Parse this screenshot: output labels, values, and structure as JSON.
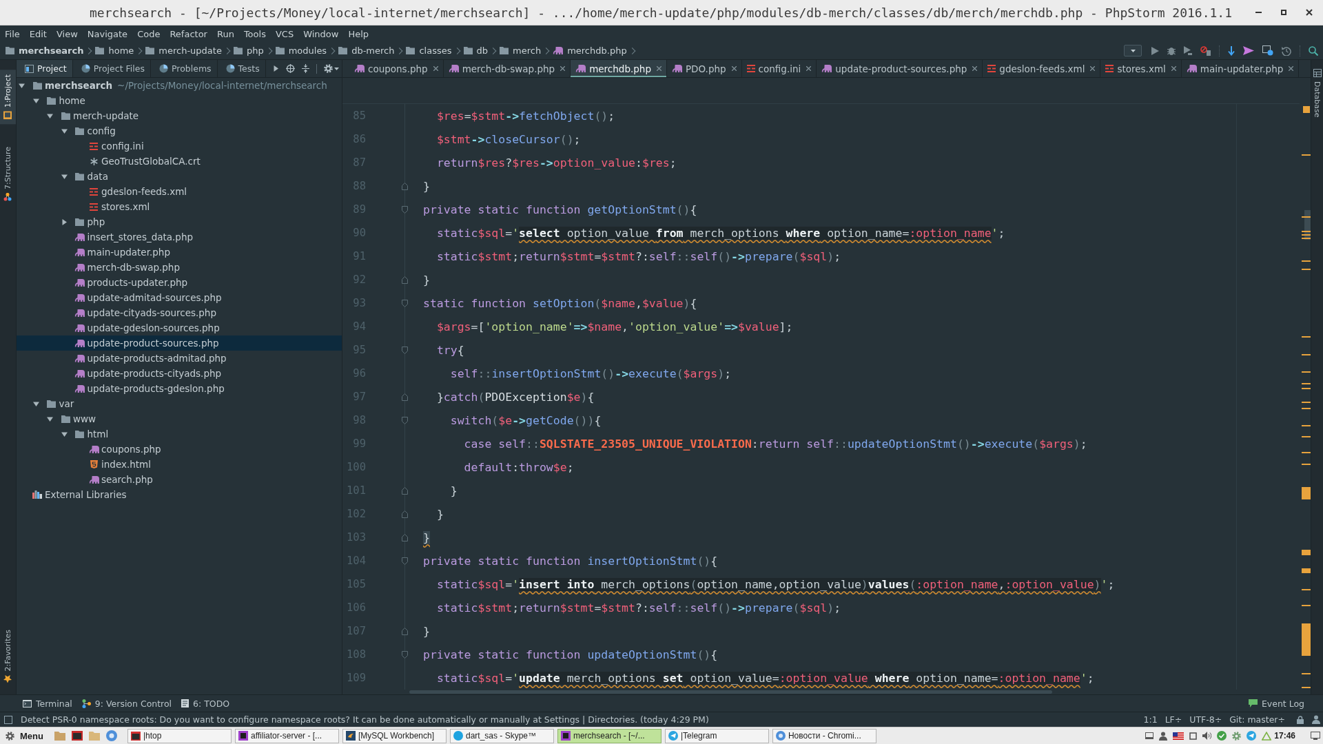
{
  "window": {
    "title": "merchsearch - [~/Projects/Money/local-internet/merchsearch] - .../home/merch-update/php/modules/db-merch/classes/db/merch/merchdb.php - PhpStorm 2016.1.1"
  },
  "menu": [
    "File",
    "Edit",
    "View",
    "Navigate",
    "Code",
    "Refactor",
    "Run",
    "Tools",
    "VCS",
    "Window",
    "Help"
  ],
  "breadcrumbs": [
    {
      "label": "merchsearch",
      "kind": "project"
    },
    {
      "label": "home",
      "kind": "folder"
    },
    {
      "label": "merch-update",
      "kind": "folder"
    },
    {
      "label": "php",
      "kind": "folder"
    },
    {
      "label": "modules",
      "kind": "folder"
    },
    {
      "label": "db-merch",
      "kind": "folder"
    },
    {
      "label": "classes",
      "kind": "folder"
    },
    {
      "label": "db",
      "kind": "folder"
    },
    {
      "label": "merch",
      "kind": "folder"
    },
    {
      "label": "merchdb.php",
      "kind": "php"
    }
  ],
  "left_strip": {
    "top": [
      {
        "label": "1:Project",
        "kind": "project",
        "selected": true
      },
      {
        "label": "7:Structure",
        "kind": "structure",
        "selected": false
      }
    ],
    "bottom": [
      {
        "label": "2:Favorites",
        "kind": "favorites",
        "selected": false
      }
    ]
  },
  "project": {
    "tabs": [
      {
        "label": "Project",
        "kind": "project",
        "selected": true
      },
      {
        "label": "Project Files",
        "kind": "files",
        "selected": false
      },
      {
        "label": "Problems",
        "kind": "problems",
        "selected": false
      },
      {
        "label": "Tests",
        "kind": "tests",
        "selected": false
      }
    ],
    "tree": [
      {
        "label": "merchsearch",
        "path": "~/Projects/Money/local-internet/merchsearch",
        "kind": "project",
        "expanded": true,
        "selected": false,
        "children": [
          {
            "label": "home",
            "kind": "folder",
            "expanded": true,
            "selected": false,
            "children": [
              {
                "label": "merch-update",
                "kind": "folder",
                "expanded": true,
                "selected": false,
                "children": [
                  {
                    "label": "config",
                    "kind": "folder",
                    "expanded": true,
                    "selected": false,
                    "children": [
                      {
                        "label": "config.ini",
                        "kind": "ini",
                        "selected": false
                      },
                      {
                        "label": "GeoTrustGlobalCA.crt",
                        "kind": "crt",
                        "selected": false
                      }
                    ]
                  },
                  {
                    "label": "data",
                    "kind": "folder",
                    "expanded": true,
                    "selected": false,
                    "children": [
                      {
                        "label": "gdeslon-feeds.xml",
                        "kind": "xml",
                        "selected": false
                      },
                      {
                        "label": "stores.xml",
                        "kind": "xml",
                        "selected": false
                      }
                    ]
                  },
                  {
                    "label": "php",
                    "kind": "folder",
                    "expanded": false,
                    "selected": false
                  },
                  {
                    "label": "insert_stores_data.php",
                    "kind": "php",
                    "selected": false
                  },
                  {
                    "label": "main-updater.php",
                    "kind": "php",
                    "selected": false
                  },
                  {
                    "label": "merch-db-swap.php",
                    "kind": "php",
                    "selected": false
                  },
                  {
                    "label": "products-updater.php",
                    "kind": "php",
                    "selected": false
                  },
                  {
                    "label": "update-admitad-sources.php",
                    "kind": "php",
                    "selected": false
                  },
                  {
                    "label": "update-cityads-sources.php",
                    "kind": "php",
                    "selected": false
                  },
                  {
                    "label": "update-gdeslon-sources.php",
                    "kind": "php",
                    "selected": false
                  },
                  {
                    "label": "update-product-sources.php",
                    "kind": "php",
                    "selected": true
                  },
                  {
                    "label": "update-products-admitad.php",
                    "kind": "php",
                    "selected": false
                  },
                  {
                    "label": "update-products-cityads.php",
                    "kind": "php",
                    "selected": false
                  },
                  {
                    "label": "update-products-gdeslon.php",
                    "kind": "php",
                    "selected": false
                  }
                ]
              }
            ]
          },
          {
            "label": "var",
            "kind": "folder",
            "expanded": true,
            "selected": false,
            "children": [
              {
                "label": "www",
                "kind": "folder",
                "expanded": true,
                "selected": false,
                "children": [
                  {
                    "label": "html",
                    "kind": "folder",
                    "expanded": true,
                    "selected": false,
                    "children": [
                      {
                        "label": "coupons.php",
                        "kind": "php",
                        "selected": false
                      },
                      {
                        "label": "index.html",
                        "kind": "html",
                        "selected": false
                      },
                      {
                        "label": "search.php",
                        "kind": "php",
                        "selected": false
                      }
                    ]
                  }
                ]
              }
            ]
          }
        ]
      },
      {
        "label": "External Libraries",
        "kind": "libraries",
        "selected": false
      }
    ]
  },
  "editor": {
    "tabs": [
      {
        "label": "coupons.php",
        "kind": "php",
        "selected": false
      },
      {
        "label": "merch-db-swap.php",
        "kind": "php",
        "selected": false
      },
      {
        "label": "merchdb.php",
        "kind": "php",
        "selected": true
      },
      {
        "label": "PDO.php",
        "kind": "php",
        "selected": false
      },
      {
        "label": "config.ini",
        "kind": "ini",
        "selected": false
      },
      {
        "label": "update-product-sources.php",
        "kind": "php",
        "selected": false
      },
      {
        "label": "gdeslon-feeds.xml",
        "kind": "xml",
        "selected": false
      },
      {
        "label": "stores.xml",
        "kind": "xml",
        "selected": false
      },
      {
        "label": "main-updater.php",
        "kind": "php",
        "selected": false
      }
    ],
    "lines": [
      {
        "number": "85",
        "kind": "code",
        "tokens": [
          {
            "kind": "var",
            "text": "  $res"
          },
          {
            "kind": "plain",
            "text": "="
          },
          {
            "kind": "var",
            "text": "$stmt"
          },
          {
            "kind": "arrow",
            "text": "->"
          },
          {
            "kind": "fn",
            "text": "fetchObject"
          },
          {
            "kind": "paren",
            "text": "()"
          },
          {
            "kind": "plain",
            "text": ";"
          }
        ]
      },
      {
        "number": "86",
        "kind": "code",
        "tokens": [
          {
            "kind": "var",
            "text": "  $stmt"
          },
          {
            "kind": "arrow",
            "text": "->"
          },
          {
            "kind": "fn",
            "text": "closeCursor"
          },
          {
            "kind": "paren",
            "text": "()"
          },
          {
            "kind": "plain",
            "text": ";"
          }
        ]
      },
      {
        "number": "87",
        "kind": "code",
        "tokens": [
          {
            "kind": "kw",
            "text": "  return"
          },
          {
            "kind": "var",
            "text": "$res"
          },
          {
            "kind": "plain",
            "text": "?"
          },
          {
            "kind": "var",
            "text": "$res"
          },
          {
            "kind": "arrow",
            "text": "->"
          },
          {
            "kind": "var",
            "text": "option_value"
          },
          {
            "kind": "plain",
            "text": ":"
          },
          {
            "kind": "var",
            "text": "$res"
          },
          {
            "kind": "plain",
            "text": ";"
          }
        ]
      },
      {
        "number": "88",
        "kind": "fold-end",
        "tokens": [
          {
            "kind": "plain",
            "text": "}"
          }
        ]
      },
      {
        "number": "89",
        "kind": "fold-start",
        "tokens": [
          {
            "kind": "kw",
            "text": "private static function "
          },
          {
            "kind": "fn",
            "text": "getOptionStmt"
          },
          {
            "kind": "paren",
            "text": "()"
          },
          {
            "kind": "plain",
            "text": "{"
          }
        ]
      },
      {
        "number": "90",
        "kind": "code",
        "tokens": [
          {
            "kind": "kw",
            "text": "  static"
          },
          {
            "kind": "var",
            "text": "$sql"
          },
          {
            "kind": "plain",
            "text": "="
          },
          {
            "kind": "str",
            "text": "'"
          },
          {
            "kind": "sql-kw",
            "text": "select"
          },
          {
            "kind": "sql-id",
            "text": " option_value "
          },
          {
            "kind": "sql-kw",
            "text": "from"
          },
          {
            "kind": "sql-id",
            "text": " merch_options "
          },
          {
            "kind": "sql-kw",
            "text": "where"
          },
          {
            "kind": "sql-id",
            "text": " option_name="
          },
          {
            "kind": "sql-param",
            "text": ":option_name"
          },
          {
            "kind": "str",
            "text": "'"
          },
          {
            "kind": "plain",
            "text": ";"
          }
        ]
      },
      {
        "number": "91",
        "kind": "code",
        "tokens": [
          {
            "kind": "kw",
            "text": "  static"
          },
          {
            "kind": "var",
            "text": "$stmt"
          },
          {
            "kind": "plain",
            "text": ";"
          },
          {
            "kind": "kw",
            "text": "return"
          },
          {
            "kind": "var",
            "text": "$stmt"
          },
          {
            "kind": "plain",
            "text": "="
          },
          {
            "kind": "var",
            "text": "$stmt"
          },
          {
            "kind": "plain",
            "text": "?:"
          },
          {
            "kind": "kw",
            "text": "self"
          },
          {
            "kind": "paren",
            "text": "::"
          },
          {
            "kind": "kw",
            "text": "self"
          },
          {
            "kind": "paren",
            "text": "()"
          },
          {
            "kind": "arrow",
            "text": "->"
          },
          {
            "kind": "fn",
            "text": "prepare"
          },
          {
            "kind": "paren",
            "text": "("
          },
          {
            "kind": "var",
            "text": "$sql"
          },
          {
            "kind": "paren",
            "text": ")"
          },
          {
            "kind": "plain",
            "text": ";"
          }
        ]
      },
      {
        "number": "92",
        "kind": "fold-end",
        "tokens": [
          {
            "kind": "plain",
            "text": "}"
          }
        ]
      },
      {
        "number": "93",
        "kind": "fold-start",
        "tokens": [
          {
            "kind": "kw",
            "text": "static function "
          },
          {
            "kind": "fn",
            "text": "setOption"
          },
          {
            "kind": "paren",
            "text": "("
          },
          {
            "kind": "var",
            "text": "$name"
          },
          {
            "kind": "plain",
            "text": ","
          },
          {
            "kind": "var",
            "text": "$value"
          },
          {
            "kind": "paren",
            "text": ")"
          },
          {
            "kind": "plain",
            "text": "{"
          }
        ]
      },
      {
        "number": "94",
        "kind": "code",
        "tokens": [
          {
            "kind": "var",
            "text": "  $args"
          },
          {
            "kind": "plain",
            "text": "=["
          },
          {
            "kind": "str",
            "text": "'option_name'"
          },
          {
            "kind": "arrow",
            "text": "=>"
          },
          {
            "kind": "var",
            "text": "$name"
          },
          {
            "kind": "plain",
            "text": ","
          },
          {
            "kind": "str",
            "text": "'option_value'"
          },
          {
            "kind": "arrow",
            "text": "=>"
          },
          {
            "kind": "var",
            "text": "$value"
          },
          {
            "kind": "plain",
            "text": "];"
          }
        ]
      },
      {
        "number": "95",
        "kind": "fold-start",
        "tokens": [
          {
            "kind": "kw",
            "text": "  try"
          },
          {
            "kind": "plain",
            "text": "{"
          }
        ]
      },
      {
        "number": "96",
        "kind": "code",
        "tokens": [
          {
            "kind": "kw",
            "text": "    self"
          },
          {
            "kind": "paren",
            "text": "::"
          },
          {
            "kind": "fn",
            "text": "insertOptionStmt"
          },
          {
            "kind": "paren",
            "text": "()"
          },
          {
            "kind": "arrow",
            "text": "->"
          },
          {
            "kind": "fn",
            "text": "execute"
          },
          {
            "kind": "paren",
            "text": "("
          },
          {
            "kind": "var",
            "text": "$args"
          },
          {
            "kind": "paren",
            "text": ")"
          },
          {
            "kind": "plain",
            "text": ";"
          }
        ]
      },
      {
        "number": "97",
        "kind": "fold-end",
        "tokens": [
          {
            "kind": "plain",
            "text": "  }"
          },
          {
            "kind": "kw",
            "text": "catch"
          },
          {
            "kind": "paren",
            "text": "("
          },
          {
            "kind": "class",
            "text": "PDOException"
          },
          {
            "kind": "var",
            "text": "$e"
          },
          {
            "kind": "paren",
            "text": ")"
          },
          {
            "kind": "plain",
            "text": "{"
          }
        ]
      },
      {
        "number": "98",
        "kind": "fold-start",
        "tokens": [
          {
            "kind": "kw",
            "text": "    switch"
          },
          {
            "kind": "paren",
            "text": "("
          },
          {
            "kind": "var",
            "text": "$e"
          },
          {
            "kind": "arrow",
            "text": "->"
          },
          {
            "kind": "fn",
            "text": "getCode"
          },
          {
            "kind": "paren",
            "text": "())"
          },
          {
            "kind": "plain",
            "text": "{"
          }
        ]
      },
      {
        "number": "99",
        "kind": "code",
        "tokens": [
          {
            "kind": "kw",
            "text": "      case self"
          },
          {
            "kind": "paren",
            "text": "::"
          },
          {
            "kind": "const",
            "text": "SQLSTATE_23505_UNIQUE_VIOLATION"
          },
          {
            "kind": "plain",
            "text": ":"
          },
          {
            "kind": "kw",
            "text": "return self"
          },
          {
            "kind": "paren",
            "text": "::"
          },
          {
            "kind": "fn",
            "text": "updateOptionStmt"
          },
          {
            "kind": "paren",
            "text": "()"
          },
          {
            "kind": "arrow",
            "text": "->"
          },
          {
            "kind": "fn",
            "text": "execute"
          },
          {
            "kind": "paren",
            "text": "("
          },
          {
            "kind": "var",
            "text": "$args"
          },
          {
            "kind": "paren",
            "text": ")"
          },
          {
            "kind": "plain",
            "text": ";"
          }
        ]
      },
      {
        "number": "100",
        "kind": "code",
        "tokens": [
          {
            "kind": "kw",
            "text": "      default"
          },
          {
            "kind": "plain",
            "text": ":"
          },
          {
            "kind": "kw",
            "text": "throw"
          },
          {
            "kind": "var",
            "text": "$e"
          },
          {
            "kind": "plain",
            "text": ";"
          }
        ]
      },
      {
        "number": "101",
        "kind": "fold-end",
        "tokens": [
          {
            "kind": "plain",
            "text": "    }"
          }
        ]
      },
      {
        "number": "102",
        "kind": "fold-end",
        "tokens": [
          {
            "kind": "plain",
            "text": "  }"
          }
        ]
      },
      {
        "number": "103",
        "kind": "fold-end",
        "tokens": [
          {
            "kind": "brace",
            "text": "}"
          }
        ]
      },
      {
        "number": "104",
        "kind": "fold-start",
        "tokens": [
          {
            "kind": "kw",
            "text": "private static function "
          },
          {
            "kind": "fn",
            "text": "insertOptionStmt"
          },
          {
            "kind": "paren",
            "text": "()"
          },
          {
            "kind": "plain",
            "text": "{"
          }
        ]
      },
      {
        "number": "105",
        "kind": "code",
        "tokens": [
          {
            "kind": "kw",
            "text": "  static"
          },
          {
            "kind": "var",
            "text": "$sql"
          },
          {
            "kind": "plain",
            "text": "="
          },
          {
            "kind": "str",
            "text": "'"
          },
          {
            "kind": "sql-kw",
            "text": "insert into"
          },
          {
            "kind": "sql-id",
            "text": " merch_options"
          },
          {
            "kind": "sql-punct",
            "text": "("
          },
          {
            "kind": "sql-id",
            "text": "option_name,option_value"
          },
          {
            "kind": "sql-punct",
            "text": ")"
          },
          {
            "kind": "sql-kw",
            "text": "values"
          },
          {
            "kind": "sql-punct",
            "text": "("
          },
          {
            "kind": "sql-param",
            "text": ":option_name"
          },
          {
            "kind": "sql-id",
            "text": ","
          },
          {
            "kind": "sql-param",
            "text": ":option_value"
          },
          {
            "kind": "sql-punct",
            "text": ")"
          },
          {
            "kind": "str",
            "text": "'"
          },
          {
            "kind": "plain",
            "text": ";"
          }
        ]
      },
      {
        "number": "106",
        "kind": "code",
        "tokens": [
          {
            "kind": "kw",
            "text": "  static"
          },
          {
            "kind": "var",
            "text": "$stmt"
          },
          {
            "kind": "plain",
            "text": ";"
          },
          {
            "kind": "kw",
            "text": "return"
          },
          {
            "kind": "var",
            "text": "$stmt"
          },
          {
            "kind": "plain",
            "text": "="
          },
          {
            "kind": "var",
            "text": "$stmt"
          },
          {
            "kind": "plain",
            "text": "?:"
          },
          {
            "kind": "kw",
            "text": "self"
          },
          {
            "kind": "paren",
            "text": "::"
          },
          {
            "kind": "kw",
            "text": "self"
          },
          {
            "kind": "paren",
            "text": "()"
          },
          {
            "kind": "arrow",
            "text": "->"
          },
          {
            "kind": "fn",
            "text": "prepare"
          },
          {
            "kind": "paren",
            "text": "("
          },
          {
            "kind": "var",
            "text": "$sql"
          },
          {
            "kind": "paren",
            "text": ")"
          },
          {
            "kind": "plain",
            "text": ";"
          }
        ]
      },
      {
        "number": "107",
        "kind": "fold-end",
        "tokens": [
          {
            "kind": "plain",
            "text": "}"
          }
        ]
      },
      {
        "number": "108",
        "kind": "fold-start",
        "tokens": [
          {
            "kind": "kw",
            "text": "private static function "
          },
          {
            "kind": "fn",
            "text": "updateOptionStmt"
          },
          {
            "kind": "paren",
            "text": "()"
          },
          {
            "kind": "plain",
            "text": "{"
          }
        ]
      },
      {
        "number": "109",
        "kind": "code",
        "tokens": [
          {
            "kind": "kw",
            "text": "  static"
          },
          {
            "kind": "var",
            "text": "$sql"
          },
          {
            "kind": "plain",
            "text": "="
          },
          {
            "kind": "str",
            "text": "'"
          },
          {
            "kind": "sql-kw",
            "text": "update"
          },
          {
            "kind": "sql-id",
            "text": " merch_options "
          },
          {
            "kind": "sql-kw",
            "text": "set"
          },
          {
            "kind": "sql-id",
            "text": " option_value="
          },
          {
            "kind": "sql-param",
            "text": ":option_value"
          },
          {
            "kind": "sql-kw",
            "text": " where"
          },
          {
            "kind": "sql-id",
            "text": " option_name="
          },
          {
            "kind": "sql-param",
            "text": ":option_name"
          },
          {
            "kind": "str",
            "text": "'"
          },
          {
            "kind": "plain",
            "text": ";"
          }
        ]
      }
    ]
  },
  "right_strip": [
    {
      "label": "Database",
      "kind": "database",
      "selected": false
    }
  ],
  "tool_windows": {
    "tools": [
      {
        "label": "Terminal",
        "kind": "terminal",
        "selected": false
      },
      {
        "label": "9: Version Control",
        "kind": "vcs",
        "selected": false
      },
      {
        "label": "6: TODO",
        "kind": "todo",
        "selected": false
      }
    ],
    "event_log": "Event Log"
  },
  "status_bar": {
    "message": "Detect PSR-0 namespace roots: Do you want to configure namespace roots? It can be done automatically or manually at Settings | Directories. (today 4:29 PM)",
    "fields": [
      "1:1",
      "LF÷",
      "UTF-8÷",
      "Git: master÷"
    ]
  },
  "taskbar": {
    "menu": "Menu",
    "tasks": [
      {
        "label": "|htop",
        "kind": "terminal",
        "selected": false
      },
      {
        "label": "affiliator-server - [...",
        "kind": "ide",
        "selected": false
      },
      {
        "label": "[MySQL Workbench]",
        "kind": "workbench",
        "selected": false
      },
      {
        "label": "dart_sas - Skype™",
        "kind": "skype",
        "selected": false
      },
      {
        "label": "merchsearch - [~/...",
        "kind": "ide",
        "selected": true
      },
      {
        "label": "|Telegram",
        "kind": "telegram",
        "selected": false
      },
      {
        "label": "Новости - Chromi...",
        "kind": "browser",
        "selected": false
      }
    ],
    "clock": "17:46"
  }
}
